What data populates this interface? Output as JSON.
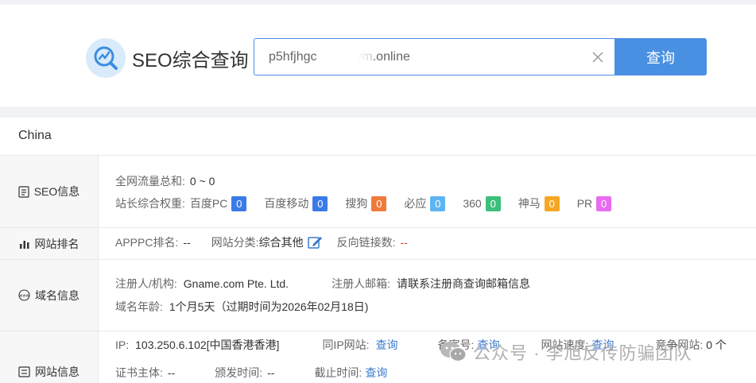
{
  "header": {
    "title": "SEO综合查询",
    "search_value": "p5hfjhgc           ym.online",
    "search_button": "查询"
  },
  "region": "China",
  "seo": {
    "section_label": "SEO信息",
    "traffic_label": "全网流量总和:",
    "traffic_value": "0 ~ 0",
    "weight_label": "站长综合权重:",
    "weights": [
      {
        "name": "百度PC",
        "value": "0",
        "color": "#3a7be8"
      },
      {
        "name": "百度移动",
        "value": "0",
        "color": "#3a7be8"
      },
      {
        "name": "搜狗",
        "value": "0",
        "color": "#f07a3c"
      },
      {
        "name": "必应",
        "value": "0",
        "color": "#5eb4f2"
      },
      {
        "name": "360",
        "value": "0",
        "color": "#3cc07a"
      },
      {
        "name": "神马",
        "value": "0",
        "color": "#f5a623"
      },
      {
        "name": "PR",
        "value": "0",
        "color": "#e86cf0"
      }
    ]
  },
  "rank": {
    "section_label": "网站排名",
    "apppc_label": "APPPC排名:",
    "apppc_value": "--",
    "category_label": "网站分类:",
    "category_value": "综合其他",
    "backlinks_label": "反向链接数:",
    "backlinks_value": "--"
  },
  "domain": {
    "section_label": "域名信息",
    "registrant_label": "注册人/机构:",
    "registrant_value": "Gname.com Pte. Ltd.",
    "email_label": "注册人邮箱:",
    "email_value": "请联系注册商查询邮箱信息",
    "age_label": "域名年龄:",
    "age_value": "1个月5天（过期时间为2026年02月18日)"
  },
  "site": {
    "section_label": "网站信息",
    "ip_label": "IP:",
    "ip_value": "103.250.6.102[中国香港香港]",
    "same_ip_label": "同IP网站:",
    "same_ip_link": "查询",
    "icp_label": "备案号:",
    "icp_link": "查询",
    "speed_label": "网站速度:",
    "speed_link": "查询",
    "competitor_label": "竞争网站:",
    "competitor_value": "0 个",
    "cert_label": "证书主体:",
    "cert_value": "--",
    "issue_label": "颁发时间:",
    "issue_value": "--",
    "expire_label": "截止时间:",
    "expire_link": "查询"
  },
  "watermark": "公众号 · 李旭反传防骗团队"
}
